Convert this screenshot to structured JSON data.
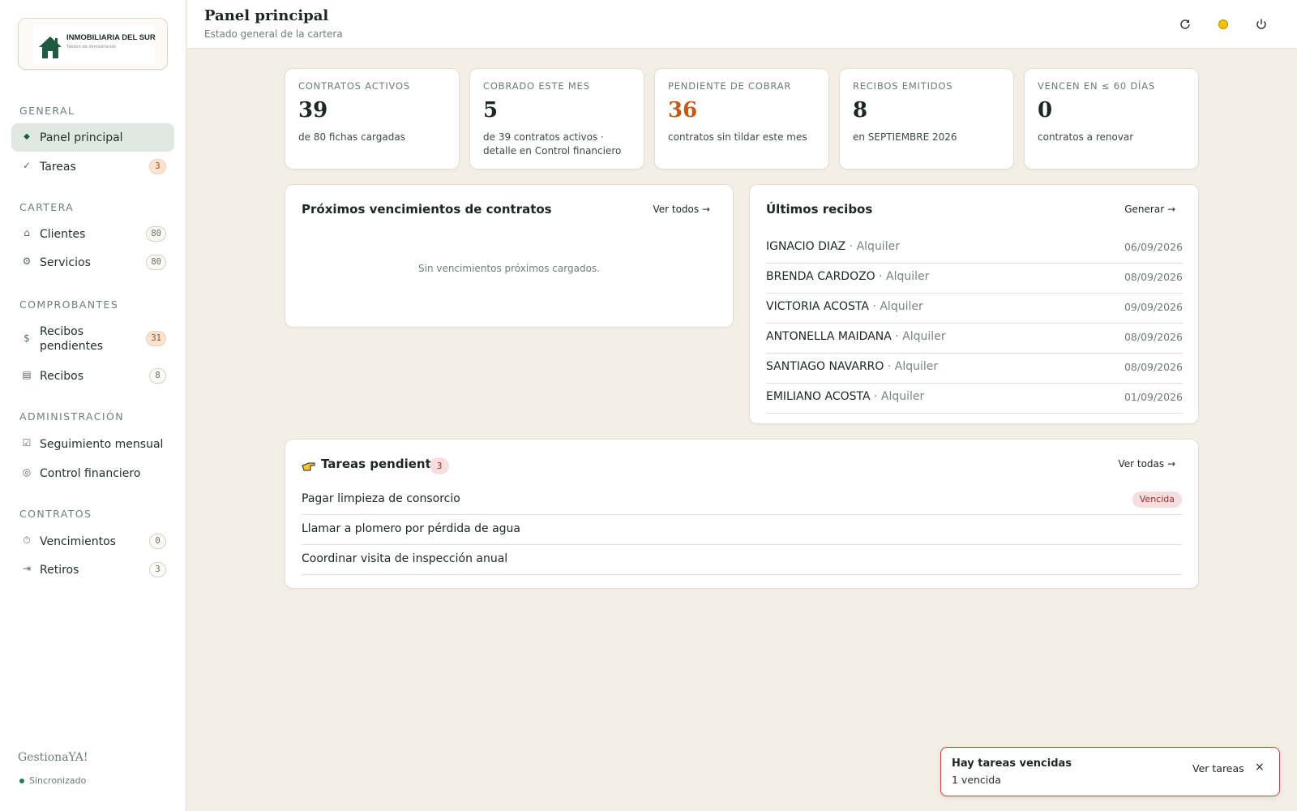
{
  "brand": {
    "company_name": "INMOBILIARIA DEL SUR",
    "company_tagline": "Tablero de demostración",
    "app_name": "GestionaYA!",
    "sync_status": "Sincronizado"
  },
  "sidebar": {
    "sections": [
      {
        "title": "GENERAL",
        "items": [
          {
            "label": "Panel principal",
            "icon": "diamond-icon",
            "badge": null,
            "active": true
          },
          {
            "label": "Tareas",
            "icon": "check-icon",
            "badge": "3"
          }
        ]
      },
      {
        "title": "CARTERA",
        "items": [
          {
            "label": "Clientes",
            "icon": "home-icon",
            "badge": "80"
          },
          {
            "label": "Servicios",
            "icon": "gear-icon",
            "badge": "80"
          }
        ]
      },
      {
        "title": "COMPROBANTES",
        "items": [
          {
            "label": "Recibos pendientes",
            "icon": "dollar-icon",
            "badge": "31"
          },
          {
            "label": "Recibos",
            "icon": "list-icon",
            "badge": "8"
          }
        ]
      },
      {
        "title": "ADMINISTRACIÓN",
        "items": [
          {
            "label": "Seguimiento mensual",
            "icon": "checkbox-icon",
            "badge": null
          },
          {
            "label": "Control financiero",
            "icon": "coin-icon",
            "badge": null
          }
        ]
      },
      {
        "title": "CONTRATOS",
        "items": [
          {
            "label": "Vencimientos",
            "icon": "stopwatch-icon",
            "badge": "0"
          },
          {
            "label": "Retiros",
            "icon": "exit-icon",
            "badge": "3"
          }
        ]
      }
    ]
  },
  "header": {
    "title": "Panel principal",
    "subtitle": "Estado general de la cartera"
  },
  "stats": [
    {
      "label": "CONTRATOS ACTIVOS",
      "value": "39",
      "sub": "de 80 fichas cargadas",
      "color": "#1d2722"
    },
    {
      "label": "COBRADO ESTE MES",
      "value": "5",
      "sub": "de 39 contratos activos · detalle en Control financiero",
      "color": "#1d2722"
    },
    {
      "label": "PENDIENTE DE COBRAR",
      "value": "36",
      "sub": "contratos sin tildar este mes",
      "color": "#c45a17"
    },
    {
      "label": "RECIBOS EMITIDOS",
      "value": "8",
      "sub": "en SEPTIEMBRE 2026",
      "color": "#1d2722"
    },
    {
      "label": "VENCEN EN ≤ 60 DÍAS",
      "value": "0",
      "sub": "contratos a renovar",
      "color": "#1d2722"
    }
  ],
  "expirations": {
    "title": "Próximos vencimientos de contratos",
    "link": "Ver todos →",
    "empty": "Sin vencimientos próximos cargados."
  },
  "receipts": {
    "title": "Últimos recibos",
    "link": "Generar →",
    "rows": [
      {
        "name": "IGNACIO DIAZ",
        "type": " · Alquiler",
        "date": "06/09/2026"
      },
      {
        "name": "BRENDA CARDOZO",
        "type": " · Alquiler",
        "date": "08/09/2026"
      },
      {
        "name": "VICTORIA ACOSTA",
        "type": " · Alquiler",
        "date": "09/09/2026"
      },
      {
        "name": "ANTONELLA MAIDANA",
        "type": " · Alquiler",
        "date": "08/09/2026"
      },
      {
        "name": "SANTIAGO NAVARRO",
        "type": " · Alquiler",
        "date": "08/09/2026"
      },
      {
        "name": "EMILIANO ACOSTA",
        "type": " · Alquiler",
        "date": "01/09/2026"
      }
    ]
  },
  "tasks": {
    "title": "Tareas pendientes",
    "count": "3",
    "link": "Ver todas →",
    "rows": [
      {
        "text": "Pagar limpieza de consorcio",
        "badge": "Vencida"
      },
      {
        "text": "Llamar a plomero por pérdida de agua",
        "badge": null
      },
      {
        "text": "Coordinar visita de inspección anual",
        "badge": null
      }
    ]
  },
  "toast": {
    "title": "Hay tareas vencidas",
    "subtitle": "1 vencida",
    "action": "Ver tareas",
    "close": "×"
  }
}
